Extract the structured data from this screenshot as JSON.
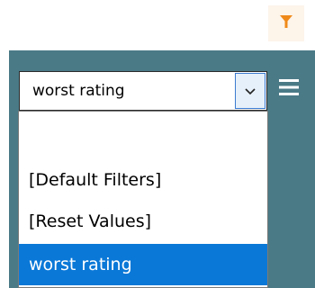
{
  "toolbar": {
    "filter_icon": "funnel-icon",
    "filter_icon_color": "#ef8a1a"
  },
  "filter_select": {
    "value": "worst rating",
    "arrow_icon": "chevron-down-icon"
  },
  "menu": {
    "icon": "hamburger-menu-icon"
  },
  "dropdown": {
    "options": [
      {
        "label": ""
      },
      {
        "label": "[Default Filters]"
      },
      {
        "label": "[Reset Values]"
      },
      {
        "label": "worst rating",
        "selected": true
      }
    ],
    "highlight_color": "#0a78d7"
  },
  "colors": {
    "panel_background": "#4a7a86"
  }
}
